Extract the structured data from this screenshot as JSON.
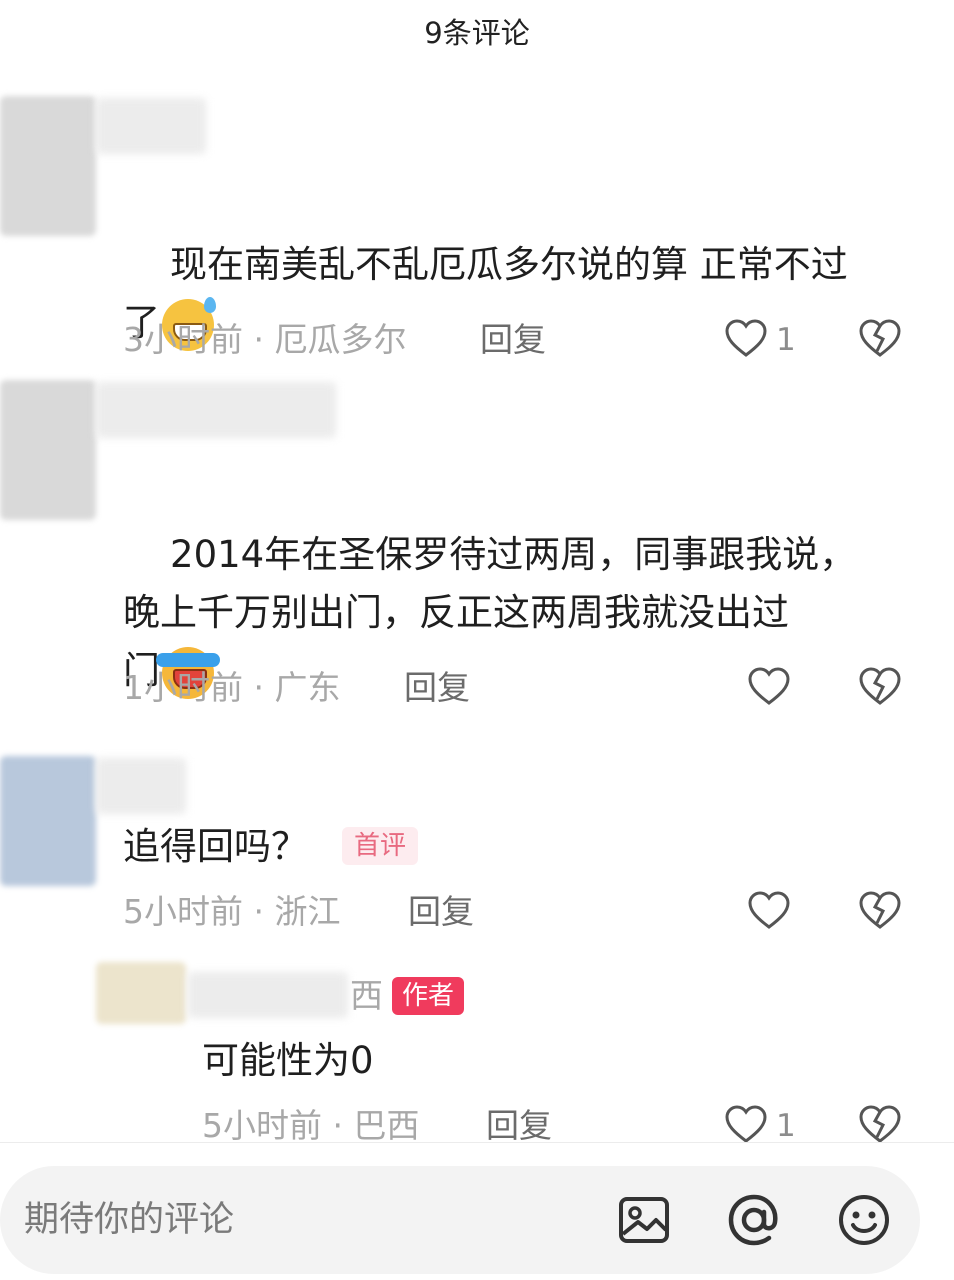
{
  "header": {
    "title": "9条评论"
  },
  "comments": [
    {
      "text": "现在南美乱不乱厄瓜多尔说的算 正常不过\n了",
      "time": "3小时前",
      "location": "厄瓜多尔",
      "reply": "回复",
      "likes": "1"
    },
    {
      "text": "2014年在圣保罗待过两周，同事跟我说，\n晚上千万别出门，反正这两周我就没出过\n门",
      "time": "1小时前",
      "location": "广东",
      "reply": "回复",
      "likes": ""
    },
    {
      "text": "追得回吗？",
      "badge": "首评",
      "time": "5小时前",
      "location": "浙江",
      "reply": "回复",
      "likes": ""
    }
  ],
  "sub_reply": {
    "name_tail": "西",
    "badge": "作者",
    "text": "可能性为0",
    "time": "5小时前",
    "location": "巴西",
    "reply": "回复",
    "likes": "1"
  },
  "separator": "·",
  "input": {
    "placeholder": "期待你的评论"
  },
  "icons": [
    "image-icon",
    "at-icon",
    "emoji-icon",
    "heart-icon",
    "broken-heart-icon"
  ],
  "colors": {
    "author_badge": "#f03b5d",
    "first_badge_bg": "#fdecef",
    "first_badge_text": "#e86a80"
  }
}
